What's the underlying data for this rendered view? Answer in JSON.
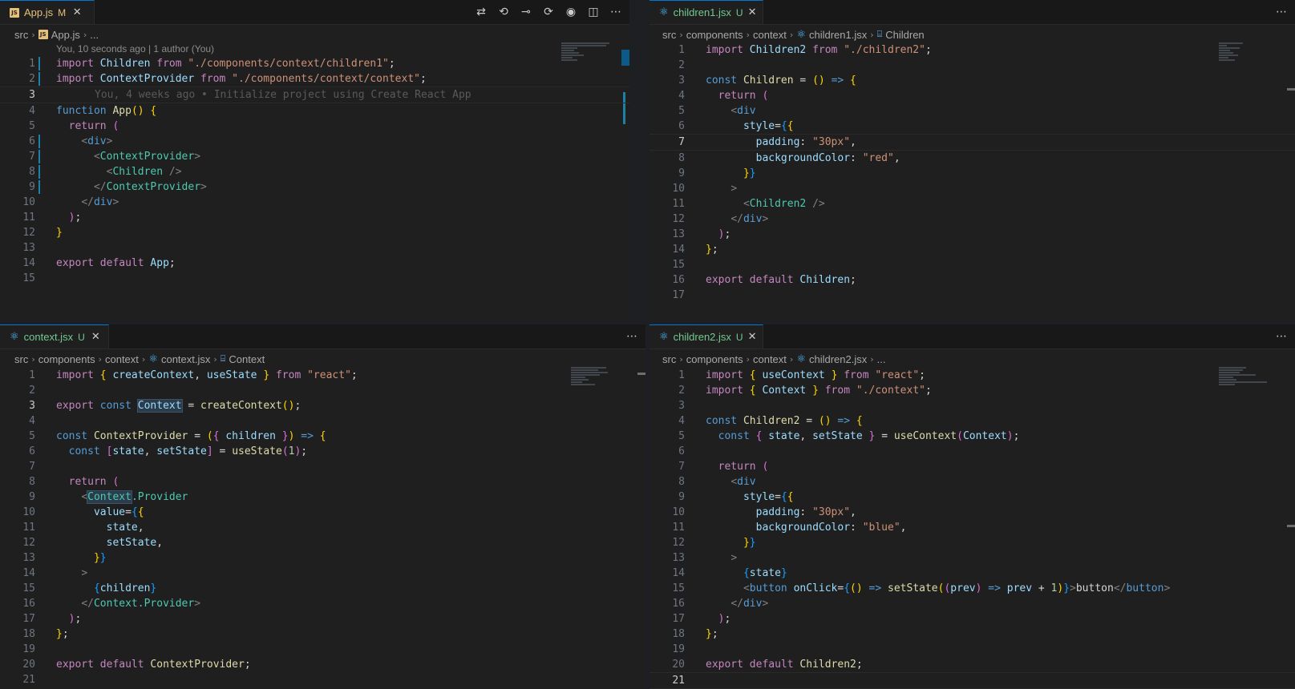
{
  "colors": {
    "accent": "#0078d4",
    "modified": "#e5c07b",
    "untracked": "#73c991"
  },
  "panes": {
    "tl": {
      "tab": {
        "name": "App.js",
        "status": "M",
        "icon": "js-file-icon"
      },
      "breadcrumb": [
        "src",
        "App.js",
        "..."
      ],
      "blame_header": "You, 10 seconds ago | 1 author (You)",
      "ghost_line": "You, 4 weeks ago • Initialize project using Create React App",
      "line_numbers": [
        "1",
        "2",
        "3",
        "4",
        "5",
        "6",
        "7",
        "8",
        "9",
        "10",
        "11",
        "12",
        "13",
        "14",
        "15"
      ]
    },
    "tr": {
      "tab": {
        "name": "children1.jsx",
        "status": "U",
        "icon": "react-file-icon"
      },
      "breadcrumb": [
        "src",
        "components",
        "context",
        "children1.jsx",
        "Children"
      ],
      "line_numbers": [
        "1",
        "2",
        "3",
        "4",
        "5",
        "6",
        "7",
        "8",
        "9",
        "10",
        "11",
        "12",
        "13",
        "14",
        "15",
        "16",
        "17"
      ]
    },
    "bl": {
      "tab": {
        "name": "context.jsx",
        "status": "U",
        "icon": "react-file-icon"
      },
      "breadcrumb": [
        "src",
        "components",
        "context",
        "context.jsx",
        "Context"
      ],
      "line_numbers": [
        "1",
        "2",
        "3",
        "4",
        "5",
        "6",
        "7",
        "8",
        "9",
        "10",
        "11",
        "12",
        "13",
        "14",
        "15",
        "16",
        "17",
        "18",
        "19",
        "20",
        "21"
      ]
    },
    "br": {
      "tab": {
        "name": "children2.jsx",
        "status": "U",
        "icon": "react-file-icon"
      },
      "breadcrumb": [
        "src",
        "components",
        "context",
        "children2.jsx",
        "..."
      ],
      "line_numbers": [
        "1",
        "2",
        "3",
        "4",
        "5",
        "6",
        "7",
        "8",
        "9",
        "10",
        "11",
        "12",
        "13",
        "14",
        "15",
        "16",
        "17",
        "18",
        "19",
        "20",
        "21"
      ]
    }
  },
  "code": {
    "app": {
      "l1a": "import",
      "l1b": "Children",
      "l1c": "from",
      "l1d": "\"./components/context/children1\"",
      "l1e": ";",
      "l2a": "import",
      "l2b": "ContextProvider",
      "l2c": "from",
      "l2d": "\"./components/context/context\"",
      "l2e": ";",
      "l4a": "function",
      "l4b": "App",
      "l4c": "(",
      "l4d": ")",
      "l4e": "{",
      "l5a": "return",
      "l5b": "(",
      "l6a": "<",
      "l6b": "div",
      "l6c": ">",
      "l7a": "<",
      "l7b": "ContextProvider",
      "l7c": ">",
      "l8a": "<",
      "l8b": "Children",
      "l8c": "/>",
      "l9a": "</",
      "l9b": "ContextProvider",
      "l9c": ">",
      "l10a": "</",
      "l10b": "div",
      "l10c": ">",
      "l11a": ")",
      "l11b": ";",
      "l12a": "}",
      "l14a": "export",
      "l14b": "default",
      "l14c": "App",
      "l14d": ";"
    },
    "c1": {
      "l1a": "import",
      "l1b": "Children2",
      "l1c": "from",
      "l1d": "\"./children2\"",
      "l1e": ";",
      "l3a": "const",
      "l3b": "Children",
      "l3c": "=",
      "l3d": "()",
      "l3e": "=>",
      "l3f": "{",
      "l4a": "return",
      "l4b": "(",
      "l5a": "<",
      "l5b": "div",
      "l6a": "style",
      "l6b": "=",
      "l6c": "{",
      "l6d": "{",
      "l7a": "padding",
      "l7b": ":",
      "l7c": "\"30px\"",
      "l7d": ",",
      "l8a": "backgroundColor",
      "l8b": ":",
      "l8c": "\"red\"",
      "l8d": ",",
      "l9a": "}",
      "l9b": "}",
      "l10a": ">",
      "l11a": "<",
      "l11b": "Children2",
      "l11c": "/>",
      "l12a": "</",
      "l12b": "div",
      "l12c": ">",
      "l13a": ")",
      "l13b": ";",
      "l14a": "}",
      "l14b": ";",
      "l16a": "export",
      "l16b": "default",
      "l16c": "Children",
      "l16d": ";"
    },
    "ctx": {
      "l1a": "import",
      "l1b": "{",
      "l1c": "createContext",
      "l1d": ",",
      "l1e": "useState",
      "l1f": "}",
      "l1g": "from",
      "l1h": "\"react\"",
      "l1i": ";",
      "l3a": "export",
      "l3b": "const",
      "l3c": "Context",
      "l3d": "=",
      "l3e": "createContext",
      "l3f": "()",
      "l3g": ";",
      "l5a": "const",
      "l5b": "ContextProvider",
      "l5c": "=",
      "l5d": "(",
      "l5e": "{",
      "l5f": "children",
      "l5g": "}",
      "l5h": ")",
      "l5i": "=>",
      "l5j": "{",
      "l6a": "const",
      "l6b": "[",
      "l6c": "state",
      "l6d": ",",
      "l6e": "setState",
      "l6f": "]",
      "l6g": "=",
      "l6h": "useState",
      "l6i": "(",
      "l6j": "1",
      "l6k": ")",
      "l6l": ";",
      "l8a": "return",
      "l8b": "(",
      "l9a": "<",
      "l9b": "Context",
      "l9c": ".Provider",
      "l10a": "value",
      "l10b": "=",
      "l10c": "{",
      "l10d": "{",
      "l11a": "state",
      "l11b": ",",
      "l12a": "setState",
      "l12b": ",",
      "l13a": "}",
      "l13b": "}",
      "l14a": ">",
      "l15a": "{",
      "l15b": "children",
      "l15c": "}",
      "l16a": "</",
      "l16b": "Context",
      "l16c": ".Provider",
      "l16d": ">",
      "l17a": ")",
      "l17b": ";",
      "l18a": "}",
      "l18b": ";",
      "l20a": "export",
      "l20b": "default",
      "l20c": "ContextProvider",
      "l20d": ";"
    },
    "c2": {
      "l1a": "import",
      "l1b": "{",
      "l1c": "useContext",
      "l1d": "}",
      "l1e": "from",
      "l1f": "\"react\"",
      "l1g": ";",
      "l2a": "import",
      "l2b": "{",
      "l2c": "Context",
      "l2d": "}",
      "l2e": "from",
      "l2f": "\"./context\"",
      "l2g": ";",
      "l4a": "const",
      "l4b": "Children2",
      "l4c": "=",
      "l4d": "()",
      "l4e": "=>",
      "l4f": "{",
      "l5a": "const",
      "l5b": "{",
      "l5c": "state",
      "l5d": ",",
      "l5e": "setState",
      "l5f": "}",
      "l5g": "=",
      "l5h": "useContext",
      "l5i": "(",
      "l5j": "Context",
      "l5k": ")",
      "l5l": ";",
      "l7a": "return",
      "l7b": "(",
      "l8a": "<",
      "l8b": "div",
      "l9a": "style",
      "l9b": "=",
      "l9c": "{",
      "l9d": "{",
      "l10a": "padding",
      "l10b": ":",
      "l10c": "\"30px\"",
      "l10d": ",",
      "l11a": "backgroundColor",
      "l11b": ":",
      "l11c": "\"blue\"",
      "l11d": ",",
      "l12a": "}",
      "l12b": "}",
      "l13a": ">",
      "l14a": "{",
      "l14b": "state",
      "l14c": "}",
      "l15a": "<",
      "l15b": "button",
      "l15c": "onClick",
      "l15d": "=",
      "l15e": "{",
      "l15f": "()",
      "l15g": "=>",
      "l15h": "setState",
      "l15i": "(",
      "l15j": "(",
      "l15k": "prev",
      "l15l": ")",
      "l15m": "=>",
      "l15n": "prev",
      "l15o": "+",
      "l15p": "1",
      "l15q": ")",
      "l15r": "}",
      "l15s": ">",
      "l15t": "button",
      "l15u": "</",
      "l15v": "button",
      "l15w": ">",
      "l16a": "</",
      "l16b": "div",
      "l16c": ">",
      "l17a": ")",
      "l17b": ";",
      "l18a": "}",
      "l18b": ";",
      "l20a": "export",
      "l20b": "default",
      "l20c": "Children2",
      "l20d": ";"
    }
  }
}
